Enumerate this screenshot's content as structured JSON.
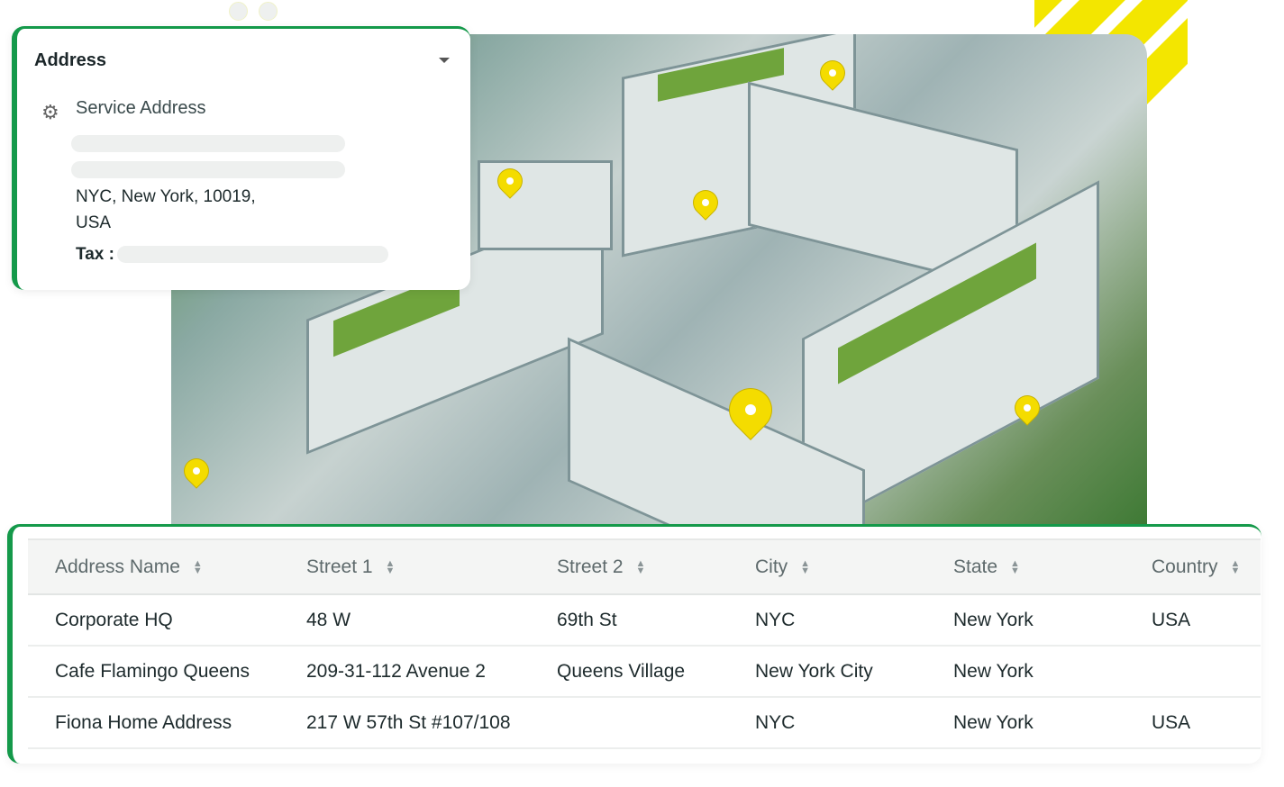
{
  "address_card": {
    "title": "Address",
    "service_label": "Service Address",
    "city_line": "NYC, New York, 10019,",
    "country_line": "USA",
    "tax_label": "Tax :"
  },
  "table": {
    "columns": [
      "Address Name",
      "Street 1",
      "Street 2",
      "City",
      "State",
      "Country"
    ],
    "rows": [
      [
        "Corporate HQ",
        "48 W",
        "69th St",
        "NYC",
        "New York",
        "USA"
      ],
      [
        "Cafe Flamingo Queens",
        "209-31-112 Avenue 2",
        "Queens Village",
        "New York City",
        "New York",
        ""
      ],
      [
        "Fiona Home Address",
        "217 W 57th St #107/108",
        "",
        "NYC",
        "New York",
        "USA"
      ]
    ]
  },
  "colors": {
    "accent": "#14994a",
    "pin": "#f4dc00",
    "stripe": "#f3e600"
  }
}
